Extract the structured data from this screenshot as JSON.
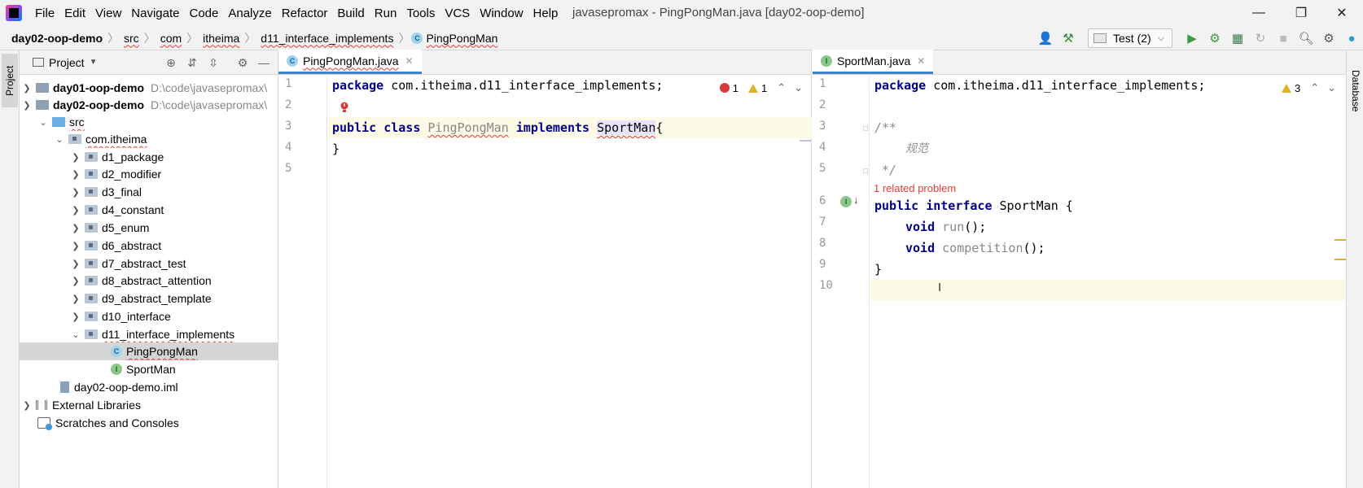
{
  "menubar": {
    "items": [
      "File",
      "Edit",
      "View",
      "Navigate",
      "Code",
      "Analyze",
      "Refactor",
      "Build",
      "Run",
      "Tools",
      "VCS",
      "Window",
      "Help"
    ],
    "window_title": "javasepromax - PingPongMan.java [day02-oop-demo]"
  },
  "navbar": {
    "crumbs": [
      "day02-oop-demo",
      "src",
      "com",
      "itheima",
      "d11_interface_implements",
      "PingPongMan"
    ],
    "run_config": "Test (2)"
  },
  "left_strip": {
    "project_label": "Project"
  },
  "right_strip": {
    "database_label": "Database"
  },
  "project": {
    "title": "Project",
    "tree": [
      {
        "label": "day01-oop-demo",
        "path": "D:\\code\\javasepromax\\"
      },
      {
        "label": "day02-oop-demo",
        "path": "D:\\code\\javasepromax\\"
      },
      {
        "label": "src"
      },
      {
        "label": "com.itheima"
      },
      {
        "label": "d1_package"
      },
      {
        "label": "d2_modifier"
      },
      {
        "label": "d3_final"
      },
      {
        "label": "d4_constant"
      },
      {
        "label": "d5_enum"
      },
      {
        "label": "d6_abstract"
      },
      {
        "label": "d7_abstract_test"
      },
      {
        "label": "d8_abstract_attention"
      },
      {
        "label": "d9_abstract_template"
      },
      {
        "label": "d10_interface"
      },
      {
        "label": "d11_interface_implements"
      },
      {
        "label": "PingPongMan"
      },
      {
        "label": "SportMan"
      },
      {
        "label": "day02-oop-demo.iml"
      },
      {
        "label": "External Libraries"
      },
      {
        "label": "Scratches and Consoles"
      }
    ]
  },
  "editor_left": {
    "tab": "PingPongMan.java",
    "errors": "1",
    "warnings": "1",
    "line_numbers": [
      "1",
      "2",
      "3",
      "4",
      "5"
    ],
    "line1": {
      "kw": "package",
      "rest": " com.itheima.d11_interface_implements;"
    },
    "line3": {
      "kw1": "public",
      "kw2": "class",
      "name": "PingPongMan",
      "kw3": "implements",
      "iface": "SportMan",
      "brace": "{"
    },
    "line4": "}"
  },
  "editor_right": {
    "tab": "SportMan.java",
    "warnings": "3",
    "line_numbers": [
      "1",
      "2",
      "3",
      "4",
      "5",
      "6",
      "7",
      "8",
      "9",
      "10"
    ],
    "line1": {
      "kw": "package",
      "rest": " com.itheima.d11_interface_implements;"
    },
    "line3": "/**",
    "line4": "规范",
    "line5": " */",
    "related_problem": "1 related problem",
    "line6": {
      "kw1": "public",
      "kw2": "interface",
      "rest": " SportMan {"
    },
    "line7": {
      "kw": "void",
      "name": "run",
      "rest": "();"
    },
    "line8": {
      "kw": "void",
      "name": "competition",
      "rest": "();"
    },
    "line9": "}"
  },
  "colors": {
    "keyword": "#00008b",
    "error": "#d73a3a",
    "warning": "#e0b02a",
    "tab_underline": "#4083c9"
  }
}
